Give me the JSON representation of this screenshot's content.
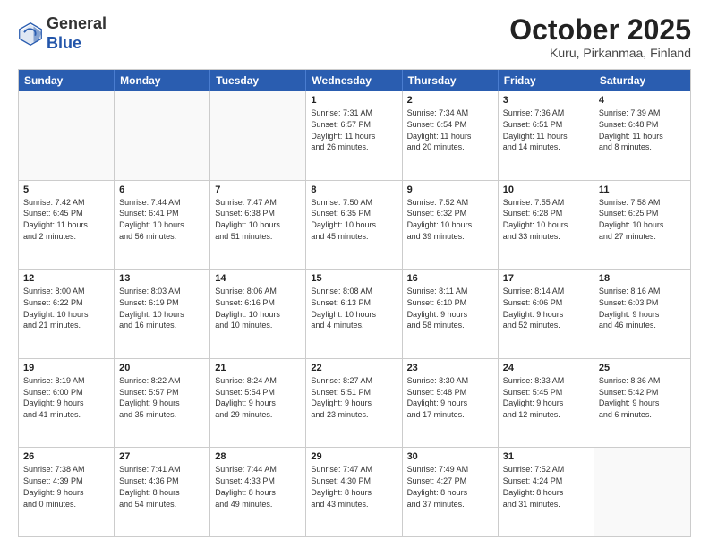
{
  "header": {
    "logo_general": "General",
    "logo_blue": "Blue",
    "month_title": "October 2025",
    "location": "Kuru, Pirkanmaa, Finland"
  },
  "weekdays": [
    "Sunday",
    "Monday",
    "Tuesday",
    "Wednesday",
    "Thursday",
    "Friday",
    "Saturday"
  ],
  "weeks": [
    [
      {
        "day": "",
        "lines": []
      },
      {
        "day": "",
        "lines": []
      },
      {
        "day": "",
        "lines": []
      },
      {
        "day": "1",
        "lines": [
          "Sunrise: 7:31 AM",
          "Sunset: 6:57 PM",
          "Daylight: 11 hours",
          "and 26 minutes."
        ]
      },
      {
        "day": "2",
        "lines": [
          "Sunrise: 7:34 AM",
          "Sunset: 6:54 PM",
          "Daylight: 11 hours",
          "and 20 minutes."
        ]
      },
      {
        "day": "3",
        "lines": [
          "Sunrise: 7:36 AM",
          "Sunset: 6:51 PM",
          "Daylight: 11 hours",
          "and 14 minutes."
        ]
      },
      {
        "day": "4",
        "lines": [
          "Sunrise: 7:39 AM",
          "Sunset: 6:48 PM",
          "Daylight: 11 hours",
          "and 8 minutes."
        ]
      }
    ],
    [
      {
        "day": "5",
        "lines": [
          "Sunrise: 7:42 AM",
          "Sunset: 6:45 PM",
          "Daylight: 11 hours",
          "and 2 minutes."
        ]
      },
      {
        "day": "6",
        "lines": [
          "Sunrise: 7:44 AM",
          "Sunset: 6:41 PM",
          "Daylight: 10 hours",
          "and 56 minutes."
        ]
      },
      {
        "day": "7",
        "lines": [
          "Sunrise: 7:47 AM",
          "Sunset: 6:38 PM",
          "Daylight: 10 hours",
          "and 51 minutes."
        ]
      },
      {
        "day": "8",
        "lines": [
          "Sunrise: 7:50 AM",
          "Sunset: 6:35 PM",
          "Daylight: 10 hours",
          "and 45 minutes."
        ]
      },
      {
        "day": "9",
        "lines": [
          "Sunrise: 7:52 AM",
          "Sunset: 6:32 PM",
          "Daylight: 10 hours",
          "and 39 minutes."
        ]
      },
      {
        "day": "10",
        "lines": [
          "Sunrise: 7:55 AM",
          "Sunset: 6:28 PM",
          "Daylight: 10 hours",
          "and 33 minutes."
        ]
      },
      {
        "day": "11",
        "lines": [
          "Sunrise: 7:58 AM",
          "Sunset: 6:25 PM",
          "Daylight: 10 hours",
          "and 27 minutes."
        ]
      }
    ],
    [
      {
        "day": "12",
        "lines": [
          "Sunrise: 8:00 AM",
          "Sunset: 6:22 PM",
          "Daylight: 10 hours",
          "and 21 minutes."
        ]
      },
      {
        "day": "13",
        "lines": [
          "Sunrise: 8:03 AM",
          "Sunset: 6:19 PM",
          "Daylight: 10 hours",
          "and 16 minutes."
        ]
      },
      {
        "day": "14",
        "lines": [
          "Sunrise: 8:06 AM",
          "Sunset: 6:16 PM",
          "Daylight: 10 hours",
          "and 10 minutes."
        ]
      },
      {
        "day": "15",
        "lines": [
          "Sunrise: 8:08 AM",
          "Sunset: 6:13 PM",
          "Daylight: 10 hours",
          "and 4 minutes."
        ]
      },
      {
        "day": "16",
        "lines": [
          "Sunrise: 8:11 AM",
          "Sunset: 6:10 PM",
          "Daylight: 9 hours",
          "and 58 minutes."
        ]
      },
      {
        "day": "17",
        "lines": [
          "Sunrise: 8:14 AM",
          "Sunset: 6:06 PM",
          "Daylight: 9 hours",
          "and 52 minutes."
        ]
      },
      {
        "day": "18",
        "lines": [
          "Sunrise: 8:16 AM",
          "Sunset: 6:03 PM",
          "Daylight: 9 hours",
          "and 46 minutes."
        ]
      }
    ],
    [
      {
        "day": "19",
        "lines": [
          "Sunrise: 8:19 AM",
          "Sunset: 6:00 PM",
          "Daylight: 9 hours",
          "and 41 minutes."
        ]
      },
      {
        "day": "20",
        "lines": [
          "Sunrise: 8:22 AM",
          "Sunset: 5:57 PM",
          "Daylight: 9 hours",
          "and 35 minutes."
        ]
      },
      {
        "day": "21",
        "lines": [
          "Sunrise: 8:24 AM",
          "Sunset: 5:54 PM",
          "Daylight: 9 hours",
          "and 29 minutes."
        ]
      },
      {
        "day": "22",
        "lines": [
          "Sunrise: 8:27 AM",
          "Sunset: 5:51 PM",
          "Daylight: 9 hours",
          "and 23 minutes."
        ]
      },
      {
        "day": "23",
        "lines": [
          "Sunrise: 8:30 AM",
          "Sunset: 5:48 PM",
          "Daylight: 9 hours",
          "and 17 minutes."
        ]
      },
      {
        "day": "24",
        "lines": [
          "Sunrise: 8:33 AM",
          "Sunset: 5:45 PM",
          "Daylight: 9 hours",
          "and 12 minutes."
        ]
      },
      {
        "day": "25",
        "lines": [
          "Sunrise: 8:36 AM",
          "Sunset: 5:42 PM",
          "Daylight: 9 hours",
          "and 6 minutes."
        ]
      }
    ],
    [
      {
        "day": "26",
        "lines": [
          "Sunrise: 7:38 AM",
          "Sunset: 4:39 PM",
          "Daylight: 9 hours",
          "and 0 minutes."
        ]
      },
      {
        "day": "27",
        "lines": [
          "Sunrise: 7:41 AM",
          "Sunset: 4:36 PM",
          "Daylight: 8 hours",
          "and 54 minutes."
        ]
      },
      {
        "day": "28",
        "lines": [
          "Sunrise: 7:44 AM",
          "Sunset: 4:33 PM",
          "Daylight: 8 hours",
          "and 49 minutes."
        ]
      },
      {
        "day": "29",
        "lines": [
          "Sunrise: 7:47 AM",
          "Sunset: 4:30 PM",
          "Daylight: 8 hours",
          "and 43 minutes."
        ]
      },
      {
        "day": "30",
        "lines": [
          "Sunrise: 7:49 AM",
          "Sunset: 4:27 PM",
          "Daylight: 8 hours",
          "and 37 minutes."
        ]
      },
      {
        "day": "31",
        "lines": [
          "Sunrise: 7:52 AM",
          "Sunset: 4:24 PM",
          "Daylight: 8 hours",
          "and 31 minutes."
        ]
      },
      {
        "day": "",
        "lines": []
      }
    ]
  ]
}
